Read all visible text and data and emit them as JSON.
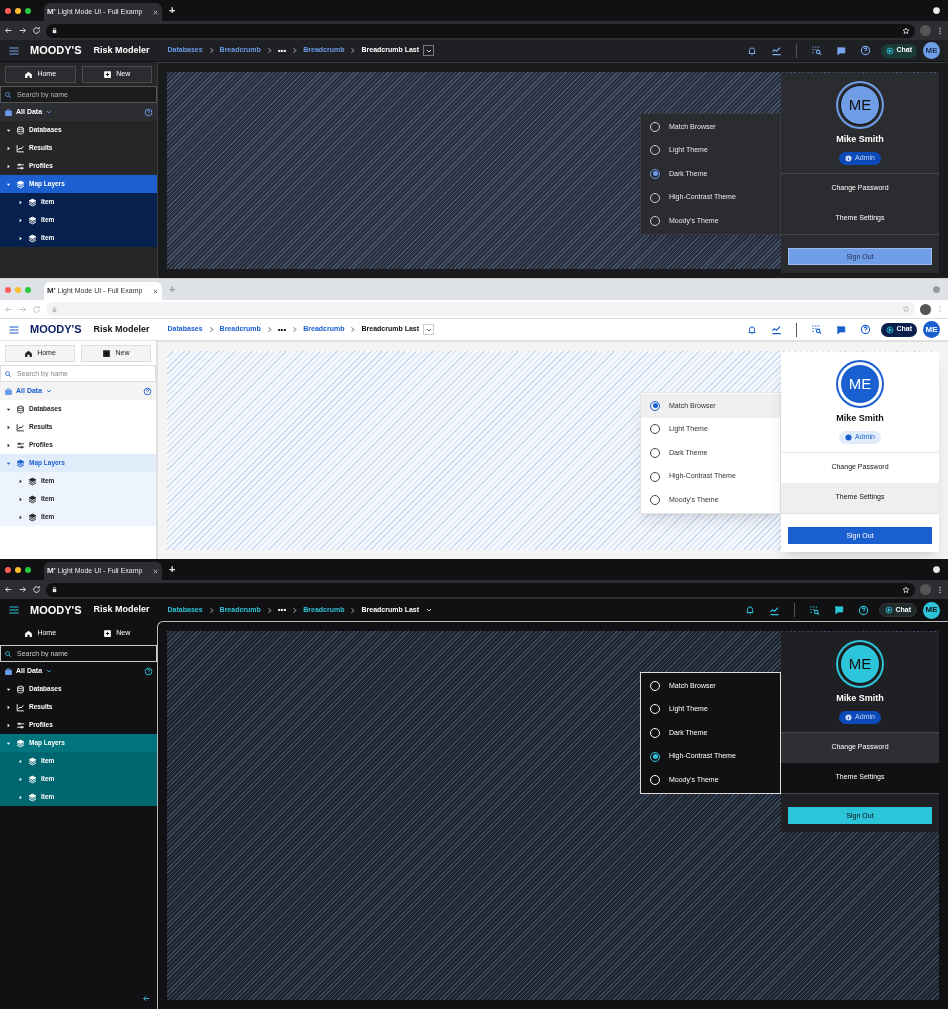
{
  "panels": [
    {
      "kind": "dark",
      "browser": {
        "favicon": "M'",
        "tab_title": "Light Mode UI - Full Examp",
        "new_tab": "+"
      },
      "header": {
        "brand": "MOODY'S",
        "app": "Risk Modeler",
        "breadcrumbs": [
          {
            "kind": "link",
            "label": "Databases"
          },
          {
            "kind": "link",
            "label": "Breadcrumb"
          },
          {
            "kind": "ellipsis",
            "label": "•••"
          },
          {
            "kind": "link",
            "label": "Breadcrumb"
          },
          {
            "kind": "current",
            "label": "Breadcrumb Last"
          }
        ],
        "chat": "Chat",
        "avatar": "ME"
      },
      "sidebar": {
        "buttons": [
          "Home",
          "New"
        ],
        "search": {
          "placeholder": "Search by name"
        },
        "scope": "All Data",
        "tree": [
          {
            "label": "Databases",
            "expanded": true,
            "selected": false
          },
          {
            "label": "Results",
            "expanded": false,
            "selected": false
          },
          {
            "label": "Profiles",
            "expanded": false,
            "selected": false
          },
          {
            "label": "Map Layers",
            "expanded": true,
            "selected": true,
            "children": [
              {
                "label": "Item",
                "expanded": false
              },
              {
                "label": "Item",
                "expanded": false
              },
              {
                "label": "Item",
                "expanded": false
              }
            ]
          }
        ]
      },
      "theme_menu": [
        {
          "label": "Match Browser",
          "selected": false,
          "hovered": false
        },
        {
          "label": "Light Theme",
          "selected": false,
          "hovered": false
        },
        {
          "label": "Dark Theme",
          "selected": true,
          "hovered": false
        },
        {
          "label": "High-Contrast Theme",
          "selected": false,
          "hovered": false
        },
        {
          "label": "Moody’s Theme",
          "selected": false,
          "hovered": false
        }
      ],
      "profile": {
        "initials": "ME",
        "name": "Mike Smith",
        "role": "Admin",
        "actions": [
          {
            "label": "Change Password",
            "hovered": false
          },
          {
            "label": "Theme Settings",
            "hovered": false
          }
        ],
        "sign_out": "Sign Out"
      }
    },
    {
      "kind": "light",
      "browser": {
        "favicon": "M'",
        "tab_title": "Light Mode UI - Full Examp",
        "new_tab": "+"
      },
      "header": {
        "brand": "MOODY'S",
        "app": "Risk Modeler",
        "breadcrumbs": [
          {
            "kind": "link",
            "label": "Databases"
          },
          {
            "kind": "link",
            "label": "Breadcrumb"
          },
          {
            "kind": "ellipsis",
            "label": "•••"
          },
          {
            "kind": "link",
            "label": "Breadcrumb"
          },
          {
            "kind": "current",
            "label": "Breadcrumb Last"
          }
        ],
        "chat": "Chat",
        "avatar": "ME"
      },
      "sidebar": {
        "buttons": [
          "Home",
          "New"
        ],
        "search": {
          "placeholder": "Search by name"
        },
        "scope": "All Data",
        "tree": [
          {
            "label": "Databases",
            "expanded": true,
            "selected": false
          },
          {
            "label": "Results",
            "expanded": false,
            "selected": false
          },
          {
            "label": "Profiles",
            "expanded": false,
            "selected": false
          },
          {
            "label": "Map Layers",
            "expanded": true,
            "selected": true,
            "children": [
              {
                "label": "Item",
                "expanded": false
              },
              {
                "label": "Item",
                "expanded": false
              },
              {
                "label": "Item",
                "expanded": false
              }
            ]
          }
        ]
      },
      "theme_menu": [
        {
          "label": "Match Browser",
          "selected": true,
          "hovered": true
        },
        {
          "label": "Light Theme",
          "selected": false,
          "hovered": false
        },
        {
          "label": "Dark Theme",
          "selected": false,
          "hovered": false
        },
        {
          "label": "High-Contrast Theme",
          "selected": false,
          "hovered": false
        },
        {
          "label": "Moody’s Theme",
          "selected": false,
          "hovered": false
        }
      ],
      "profile": {
        "initials": "ME",
        "name": "Mike Smith",
        "role": "Admin",
        "actions": [
          {
            "label": "Change Password",
            "hovered": false
          },
          {
            "label": "Theme Settings",
            "hovered": true
          }
        ],
        "sign_out": "Sign Out"
      }
    },
    {
      "kind": "contrast",
      "browser": {
        "favicon": "M'",
        "tab_title": "Light Mode UI - Full Examp",
        "new_tab": "+"
      },
      "header": {
        "brand": "MOODY'S",
        "app": "Risk Modeler",
        "breadcrumbs": [
          {
            "kind": "link",
            "label": "Databases"
          },
          {
            "kind": "link",
            "label": "Breadcrumb"
          },
          {
            "kind": "ellipsis",
            "label": "•••"
          },
          {
            "kind": "link",
            "label": "Breadcrumb"
          },
          {
            "kind": "current",
            "label": "Breadcrumb Last"
          }
        ],
        "chat": "Chat",
        "avatar": "ME"
      },
      "sidebar": {
        "buttons": [
          "Home",
          "New"
        ],
        "search": {
          "placeholder": "Search by name"
        },
        "scope": "All Data",
        "tree": [
          {
            "label": "Databases",
            "expanded": true,
            "selected": false
          },
          {
            "label": "Results",
            "expanded": false,
            "selected": false
          },
          {
            "label": "Profiles",
            "expanded": false,
            "selected": false
          },
          {
            "label": "Map Layers",
            "expanded": true,
            "selected": true,
            "children": [
              {
                "label": "Item",
                "expanded": false
              },
              {
                "label": "Item",
                "expanded": false
              },
              {
                "label": "Item",
                "expanded": false
              }
            ]
          }
        ],
        "collapse_button": true
      },
      "theme_menu": [
        {
          "label": "Match Browser",
          "selected": false,
          "hovered": false
        },
        {
          "label": "Light Theme",
          "selected": false,
          "hovered": false
        },
        {
          "label": "Dark Theme",
          "selected": false,
          "hovered": false
        },
        {
          "label": "High-Contrast Theme",
          "selected": true,
          "hovered": false
        },
        {
          "label": "Moody’s Theme",
          "selected": false,
          "hovered": false
        }
      ],
      "profile": {
        "initials": "ME",
        "name": "Mike Smith",
        "role": "Admin",
        "actions": [
          {
            "label": "Change Password",
            "hovered": true
          },
          {
            "label": "Theme Settings",
            "hovered": false
          }
        ],
        "sign_out": "Sign Out"
      }
    }
  ]
}
